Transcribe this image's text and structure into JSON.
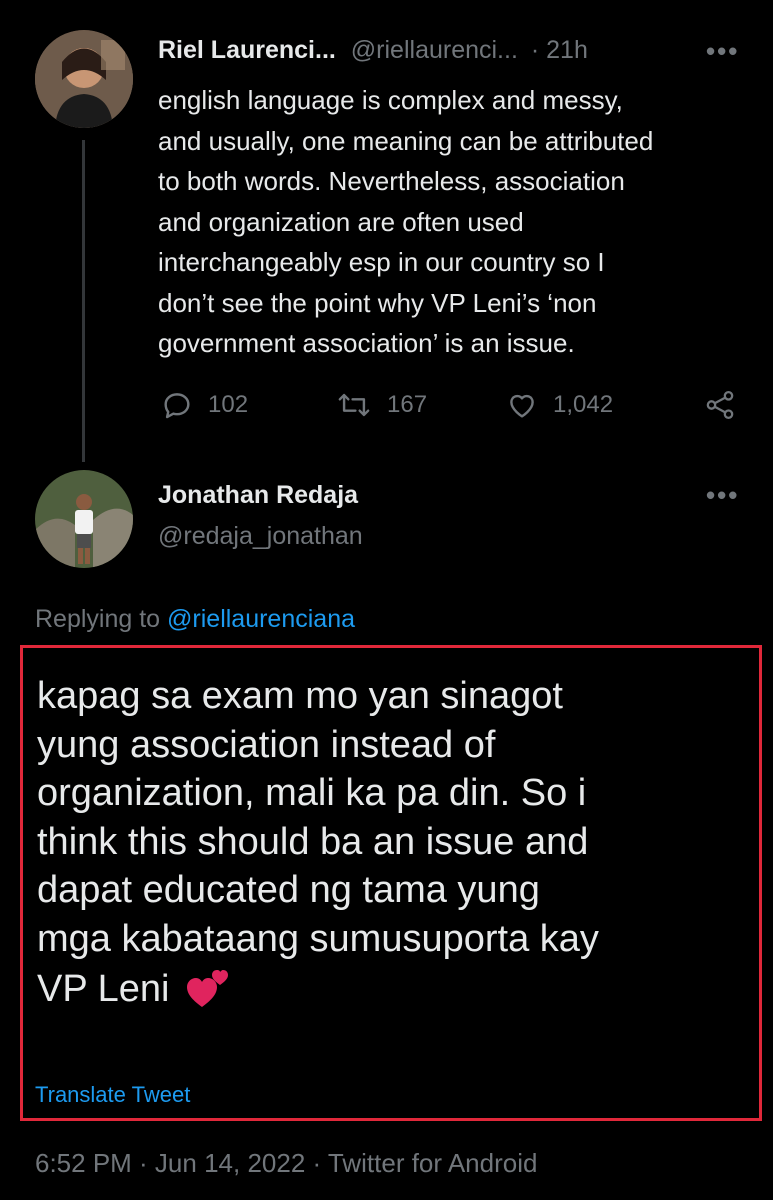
{
  "original_tweet": {
    "display_name": "Riel Laurenci...",
    "handle": "@riellaurenci...",
    "time": "· 21h",
    "more": "•••",
    "lines": [
      "english language is complex and messy,",
      "and usually, one meaning can be attributed",
      "to both words. Nevertheless, association",
      "and organization are often used",
      "interchangeably esp in our country so I",
      "don’t see the point why VP Leni’s ‘non",
      "government association’ is an issue."
    ],
    "replies": "102",
    "retweets": "167",
    "likes": "1,042"
  },
  "reply_tweet": {
    "display_name": "Jonathan Redaja",
    "handle": "@redaja_jonathan",
    "more": "•••",
    "replying_to_label": "Replying to",
    "replying_to_handle": "@riellaurenciana",
    "lines": [
      "kapag sa exam mo yan sinagot",
      "yung association instead of",
      "organization, mali ka pa din. So i",
      "think this should ba an issue and",
      "dapat educated ng tama yung",
      "mga kabataang sumusuporta kay",
      "VP Leni"
    ],
    "translate": "Translate Tweet",
    "timestamp": "6:52 PM · Jun 14, 2022 · Twitter for Android"
  },
  "colors": {
    "background": "#000000",
    "text": "#e7e9ea",
    "muted": "#71767b",
    "link": "#1d9bf0",
    "highlight_border": "#e0283a",
    "heart_emoji": "#e0245e"
  }
}
